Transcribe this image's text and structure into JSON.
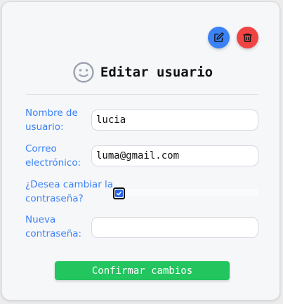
{
  "form": {
    "title": "Editar usuario",
    "fields": {
      "username": {
        "label": "Nombre de usuario:",
        "value": "lucia"
      },
      "email": {
        "label": "Correo electrónico:",
        "value": "luma@gmail.com"
      },
      "change_password": {
        "label": "¿Desea cambiar la contraseña?",
        "checked": true
      },
      "new_password": {
        "label": "Nueva contraseña:",
        "value": ""
      }
    },
    "confirm_label": "Confirmar cambios"
  },
  "colors": {
    "accent": "#3b82f6",
    "edit_button": "#3b82f6",
    "delete_button": "#ef4444",
    "confirm_button": "#22c55e"
  },
  "icons": {
    "edit": "pencil-square-icon",
    "delete": "trash-icon",
    "header": "smiley-face-icon",
    "checkbox": "checkmark-icon"
  }
}
